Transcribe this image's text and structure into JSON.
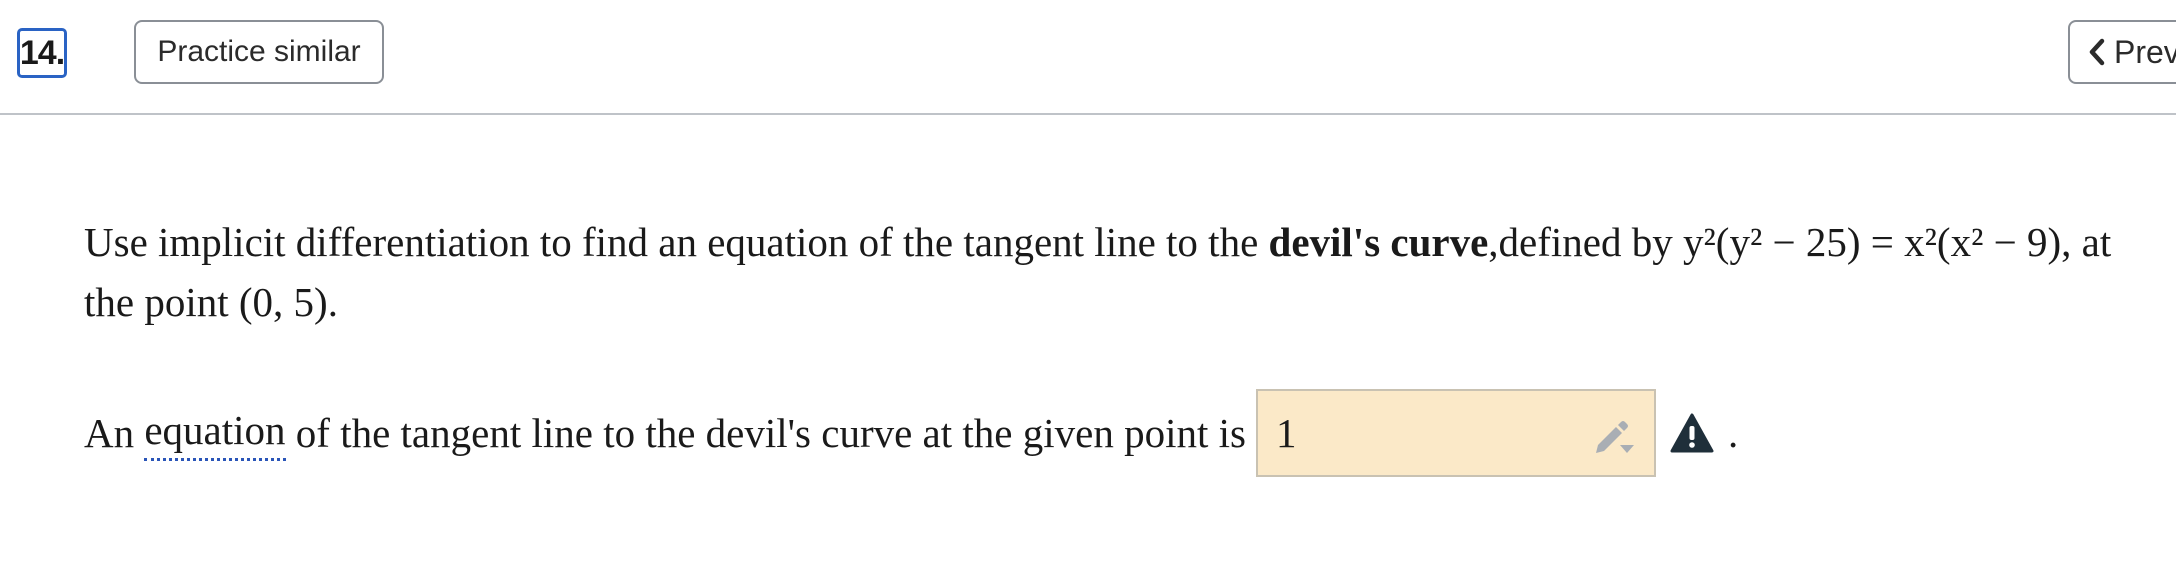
{
  "header": {
    "question_number": "14.",
    "practice_label": "Practice similar",
    "prev_label": "Prev"
  },
  "question": {
    "intro": "Use implicit differentiation to find an equation of the tangent line to the ",
    "bold_term": "devil's curve",
    "defined_by": ",defined by ",
    "equation": "y²(y² − 25) = x²(x² − 9)",
    "at_the_point": ", at the point ",
    "point": "(0, 5)",
    "end": "."
  },
  "answer": {
    "prefix": "An ",
    "link_word": "equation",
    "suffix": " of the tangent line to the devil's curve at the given point is",
    "input_value": "1",
    "period": "."
  },
  "icons": {
    "pencil": "pencil-dropdown-icon",
    "warning": "warning-triangle-icon"
  },
  "colors": {
    "accent_blue": "#2a63c4",
    "answer_box_bg": "#fbe9c8",
    "warning_dark": "#1f2f3a"
  }
}
